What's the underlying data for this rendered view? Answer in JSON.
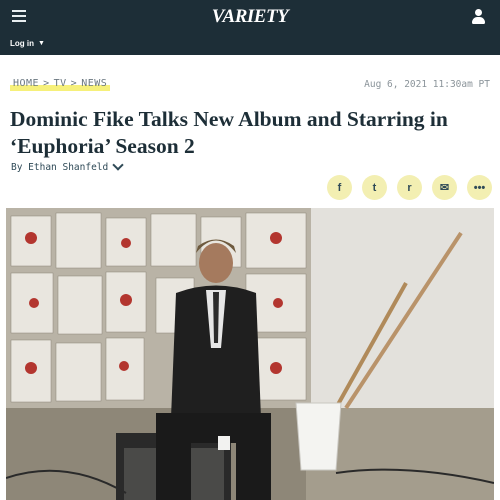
{
  "header": {
    "logo": "VARIETY",
    "login_label": "Log in",
    "login_caret": "▼"
  },
  "article": {
    "breadcrumb": [
      "HOME",
      "TV",
      "NEWS"
    ],
    "breadcrumb_sep": ">",
    "timestamp": "Aug 6, 2021 11:30am PT",
    "headline_line1": "Dominic Fike Talks New Album and Starring in",
    "headline_line2": "‘Euphoria’ Season 2",
    "byline": "By Ethan Shanfeld"
  },
  "share": {
    "facebook": "f",
    "twitter": "t",
    "reddit": "r",
    "email": "✉",
    "more": "•••"
  },
  "colors": {
    "topbar": "#1d2e37",
    "highlight": "#f6f07a",
    "share_bg": "#f3efb2"
  }
}
